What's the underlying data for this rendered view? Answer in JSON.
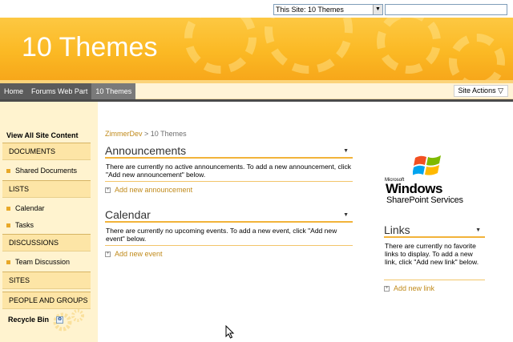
{
  "search": {
    "scope_value": "This Site: 10 Themes",
    "query_value": ""
  },
  "banner": {
    "title": "10 Themes"
  },
  "topnav": {
    "tabs": [
      {
        "label": "Home",
        "active": false
      },
      {
        "label": "Forums Web Part",
        "active": false
      },
      {
        "label": "10 Themes",
        "active": true
      }
    ],
    "site_actions": "Site Actions ▽"
  },
  "quicklaunch": {
    "view_all": "View All Site Content",
    "sections": [
      {
        "header": "DOCUMENTS",
        "items": [
          "Shared Documents"
        ]
      },
      {
        "header": "LISTS",
        "items": [
          "Calendar",
          "Tasks"
        ]
      },
      {
        "header": "DISCUSSIONS",
        "items": [
          "Team Discussion"
        ]
      },
      {
        "header": "SITES",
        "items": []
      },
      {
        "header": "PEOPLE AND GROUPS",
        "items": []
      }
    ],
    "recycle_bin": "Recycle Bin"
  },
  "breadcrumb": {
    "root": "ZimmerDev",
    "separator": ">",
    "current": "10 Themes"
  },
  "webparts": {
    "announcements": {
      "title": "Announcements",
      "body": "There are currently no active announcements. To add a new announcement, click \"Add new announcement\" below.",
      "add_link": "Add new announcement"
    },
    "calendar": {
      "title": "Calendar",
      "body": "There are currently no upcoming events. To add a new event, click \"Add new event\" below.",
      "add_link": "Add new event"
    },
    "links": {
      "title": "Links",
      "body": "There are currently no favorite links to display. To add a new link, click \"Add new link\" below.",
      "add_link": "Add new link"
    }
  },
  "logo": {
    "microsoft": "Microsoft",
    "windows": "Windows",
    "product": "SharePoint Services"
  },
  "colors": {
    "banner": "#fbb924",
    "accent_line": "#f2b33a",
    "link": "#c08a1a",
    "nav_dark": "#5b5b5b"
  }
}
